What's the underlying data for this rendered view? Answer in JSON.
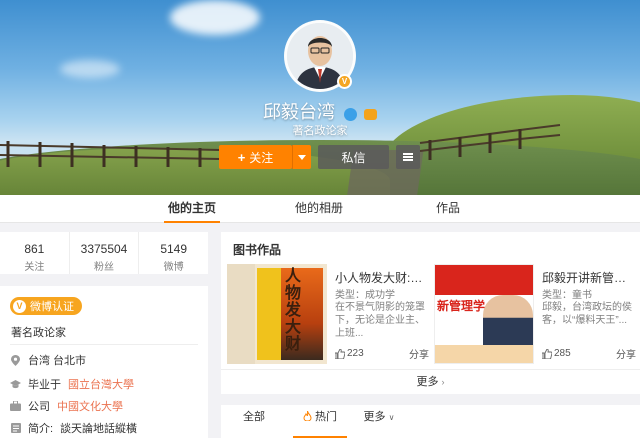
{
  "profile": {
    "name": "邱毅台湾",
    "tagline": "著名政论家",
    "follow_label": "关注",
    "message_label": "私信"
  },
  "tabs": [
    {
      "label": "他的主页",
      "active": true
    },
    {
      "label": "他的相册",
      "active": false
    },
    {
      "label": "作品",
      "active": false
    }
  ],
  "stats": [
    {
      "value": "861",
      "label": "关注"
    },
    {
      "value": "3375504",
      "label": "粉丝"
    },
    {
      "value": "5149",
      "label": "微博"
    }
  ],
  "info": {
    "cert_label": "微博认证",
    "cert_desc": "著名政论家",
    "location": "台湾 台北市",
    "education_prefix": "毕业于",
    "education": "國立台灣大學",
    "company_prefix": "公司",
    "company": "中國文化大學",
    "bio_prefix": "简介:",
    "bio": "談天論地話縱橫"
  },
  "books": {
    "title": "图书作品",
    "items": [
      {
        "title": "小人物发大财:人...",
        "type": "类型：成功学",
        "desc": "在不景气阴影的笼罩下，无论是企业主、上班...",
        "likes": "223",
        "share_label": "分享",
        "cover_text": "人物发大财"
      },
      {
        "title": "邱毅开讲新管理学",
        "type": "类型：童书",
        "desc": "邱毅，台湾政坛的侯客，以“爆料天王”...",
        "likes": "285",
        "share_label": "分享",
        "cover_text": "新管理学"
      }
    ],
    "more_label": "更多"
  },
  "filter": {
    "all": "全部",
    "hot": "热门",
    "more": "更多"
  },
  "colors": {
    "accent": "#ff8200",
    "cert": "#f7a51f",
    "link": "#eb7350"
  }
}
